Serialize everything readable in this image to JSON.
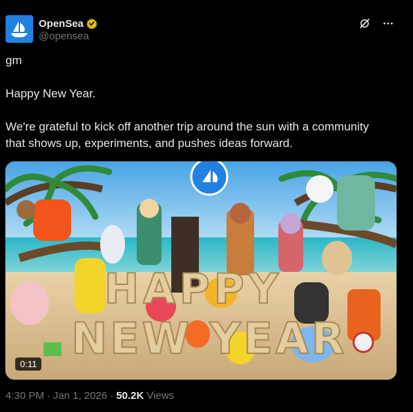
{
  "author": {
    "display_name": "OpenSea",
    "handle": "@opensea",
    "brand_color": "#2081e2",
    "verified_color": "#e2b719"
  },
  "top_actions": [
    "grok-icon",
    "more-icon"
  ],
  "post": {
    "line1": "gm",
    "line2": "Happy New Year.",
    "line3": "We're grateful to kick off another trip around the sun with a community",
    "line4": "that shows up, experiments, and pushes ideas forward."
  },
  "media": {
    "duration": "0:11",
    "sign_line1": "HAPPY",
    "sign_line2": "NEW YEAR"
  },
  "meta": {
    "time": "4:30 PM",
    "date": "Jan 1, 2026",
    "separator": "·",
    "views_count": "50.2K",
    "views_label": "Views"
  }
}
